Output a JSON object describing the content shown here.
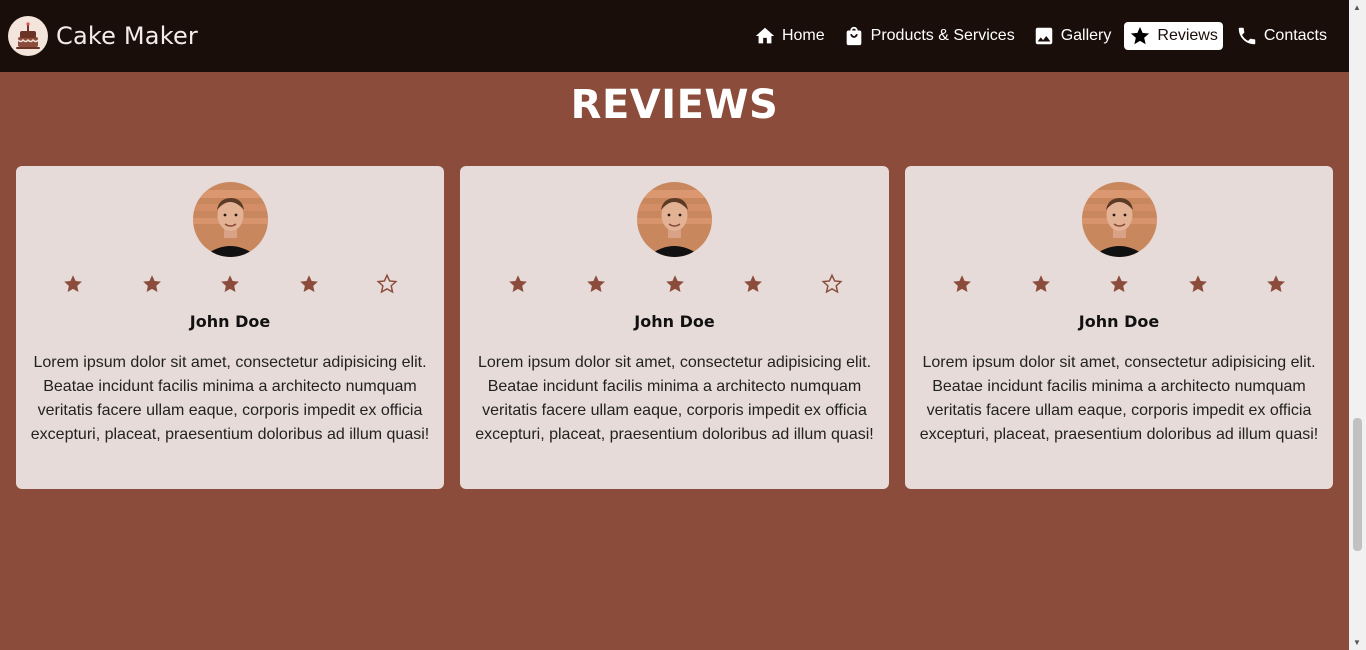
{
  "brand": {
    "name": "Cake Maker",
    "logo_icon": "cake-icon"
  },
  "nav": [
    {
      "label": "Home",
      "icon": "home-icon"
    },
    {
      "label": "Products & Services",
      "icon": "shopping-bag-icon"
    },
    {
      "label": "Gallery",
      "icon": "image-icon"
    },
    {
      "label": "Reviews",
      "icon": "star-icon",
      "active": true
    },
    {
      "label": "Contacts",
      "icon": "phone-icon"
    }
  ],
  "page_title": "REVIEWS",
  "reviews": [
    {
      "name": "John Doe",
      "rating": 4,
      "text": "Lorem ipsum dolor sit amet, consectetur adipisicing elit. Beatae incidunt facilis minima a architecto numquam veritatis facere ullam eaque, corporis impedit ex officia excepturi, placeat, praesentium doloribus ad illum quasi!"
    },
    {
      "name": "John Doe",
      "rating": 4,
      "text": "Lorem ipsum dolor sit amet, consectetur adipisicing elit. Beatae incidunt facilis minima a architecto numquam veritatis facere ullam eaque, corporis impedit ex officia excepturi, placeat, praesentium doloribus ad illum quasi!"
    },
    {
      "name": "John Doe",
      "rating": 5,
      "text": "Lorem ipsum dolor sit amet, consectetur adipisicing elit. Beatae incidunt facilis minima a architecto numquam veritatis facere ullam eaque, corporis impedit ex officia excepturi, placeat, praesentium doloribus ad illum quasi!"
    }
  ],
  "colors": {
    "page_bg": "#8b4c3b",
    "nav_bg": "#1a0e0b",
    "card_bg": "#e6dbd8",
    "star": "#8b4c3b"
  }
}
